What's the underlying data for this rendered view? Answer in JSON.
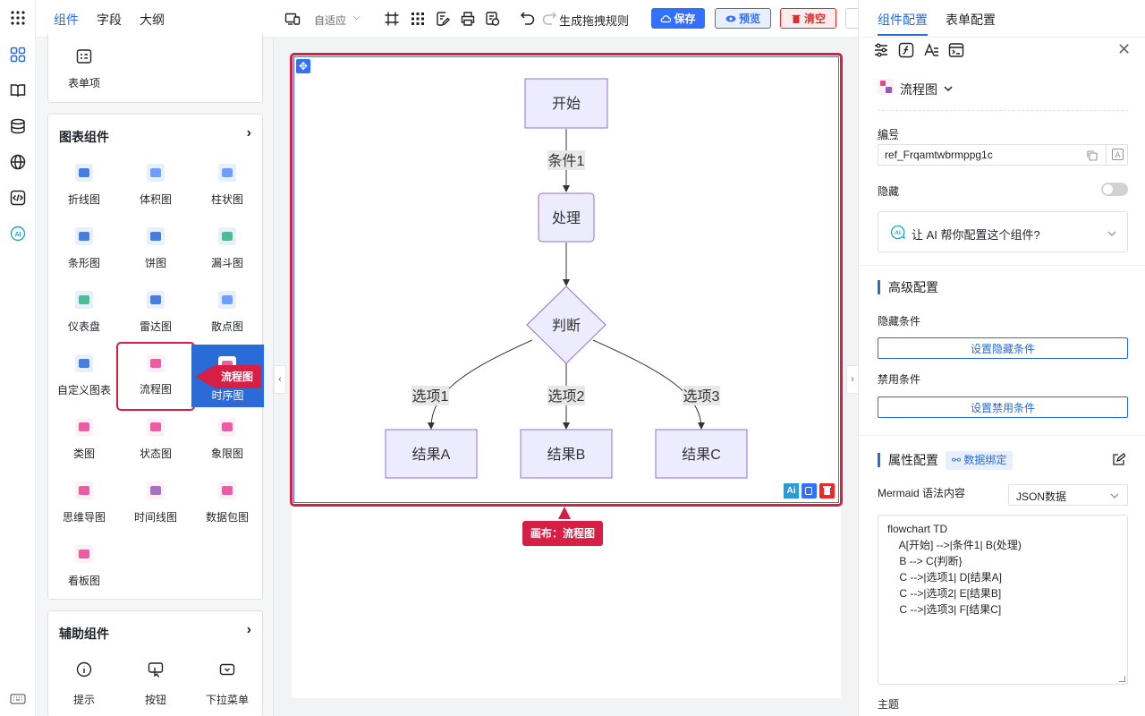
{
  "left_tabs": [
    "组件",
    "字段",
    "大纲"
  ],
  "form_section": {
    "item_label": "表单项"
  },
  "chart_section": {
    "title": "图表组件",
    "items": [
      "折线图",
      "体积图",
      "柱状图",
      "条形图",
      "饼图",
      "漏斗图",
      "仪表盘",
      "雷达图",
      "散点图",
      "自定义图表",
      "流程图",
      "时序图",
      "类图",
      "状态图",
      "象限图",
      "思维导图",
      "时间线图",
      "数据包图",
      "看板图"
    ]
  },
  "aux_section": {
    "title": "辅助组件",
    "items": [
      "提示",
      "按钮",
      "下拉菜单"
    ]
  },
  "toolbar": {
    "fit_label": "自适应",
    "gen_rule": "生成拖拽规则",
    "save": "保存",
    "preview": "预览",
    "clear": "清空"
  },
  "annotations": {
    "component_tag": "流程图",
    "canvas_tag": "画布：流程图"
  },
  "flowchart": {
    "nodes": {
      "start": "开始",
      "process": "处理",
      "decision": "判断",
      "a": "结果A",
      "b": "结果B",
      "c": "结果C"
    },
    "edges": {
      "cond1": "条件1",
      "opt1": "选项1",
      "opt2": "选项2",
      "opt3": "选项3"
    }
  },
  "right_tabs": [
    "组件配置",
    "表单配置"
  ],
  "config": {
    "component_name": "流程图",
    "id_label": "编号",
    "id_value": "ref_Frqamtwbrmppg1c",
    "hidden_label": "隐藏",
    "ai_prompt": "让 AI 帮你配置这个组件?",
    "advanced_title": "高级配置",
    "hide_cond_label": "隐藏条件",
    "hide_cond_btn": "设置隐藏条件",
    "disable_cond_label": "禁用条件",
    "disable_cond_btn": "设置禁用条件",
    "prop_title": "属性配置",
    "data_bind": "数据绑定",
    "mermaid_label": "Mermaid 语法内容",
    "format_select": "JSON数据",
    "code_lines": [
      "flowchart TD",
      "    A[开始] -->|条件1| B(处理)",
      "    B --> C{判断}",
      "    C -->|选项1| D[结果A]",
      "    C -->|选项2| E[结果B]",
      "    C -->|选项3| F[结果C]"
    ],
    "theme_label": "主题"
  },
  "colors": {
    "accent": "#2a6bd8",
    "highlight": "#d61f45",
    "node_fill": "#ececfe",
    "node_stroke": "#9370db"
  }
}
